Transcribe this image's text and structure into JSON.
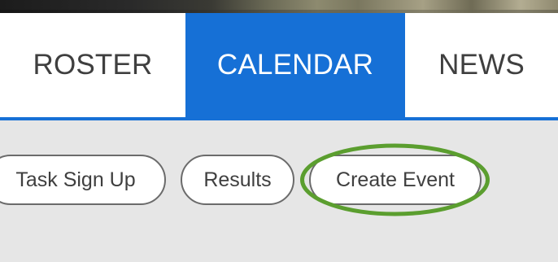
{
  "nav": {
    "tabs": [
      {
        "label": "ROSTER",
        "active": false
      },
      {
        "label": "CALENDAR",
        "active": true
      },
      {
        "label": "NEWS",
        "active": false
      }
    ],
    "active_color": "#1670d6"
  },
  "subbar": {
    "buttons": [
      {
        "label": "Task Sign Up"
      },
      {
        "label": "Results"
      },
      {
        "label": "Create Event"
      }
    ],
    "background_color": "#e6e6e6"
  },
  "highlight": {
    "target": "Create Event",
    "color": "#5b9e2f"
  }
}
